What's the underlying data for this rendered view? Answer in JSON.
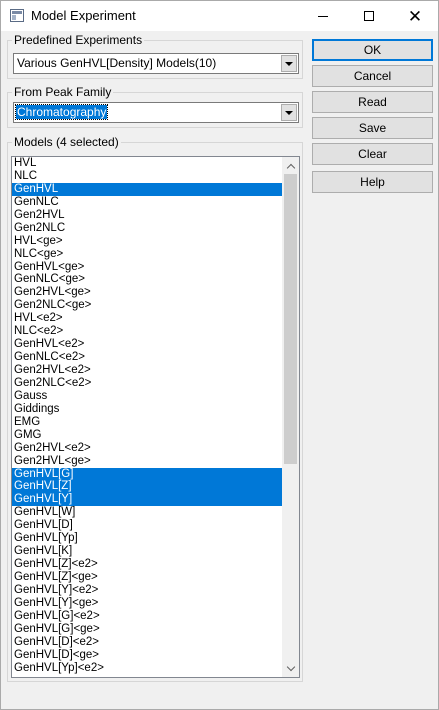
{
  "window": {
    "title": "Model Experiment"
  },
  "predefined": {
    "legend": "Predefined Experiments",
    "value": "Various GenHVL[Density] Models(10)"
  },
  "peak_family": {
    "legend": "From Peak Family",
    "value": "Chromatography"
  },
  "models": {
    "legend": "Models (4 selected)",
    "items": [
      {
        "label": "HVL",
        "selected": false
      },
      {
        "label": "NLC",
        "selected": false
      },
      {
        "label": "GenHVL",
        "selected": true
      },
      {
        "label": "GenNLC",
        "selected": false
      },
      {
        "label": "Gen2HVL",
        "selected": false
      },
      {
        "label": "Gen2NLC",
        "selected": false
      },
      {
        "label": "HVL<ge>",
        "selected": false
      },
      {
        "label": "NLC<ge>",
        "selected": false
      },
      {
        "label": "GenHVL<ge>",
        "selected": false
      },
      {
        "label": "GenNLC<ge>",
        "selected": false
      },
      {
        "label": "Gen2HVL<ge>",
        "selected": false
      },
      {
        "label": "Gen2NLC<ge>",
        "selected": false
      },
      {
        "label": "HVL<e2>",
        "selected": false
      },
      {
        "label": "NLC<e2>",
        "selected": false
      },
      {
        "label": "GenHVL<e2>",
        "selected": false
      },
      {
        "label": "GenNLC<e2>",
        "selected": false
      },
      {
        "label": "Gen2HVL<e2>",
        "selected": false
      },
      {
        "label": "Gen2NLC<e2>",
        "selected": false
      },
      {
        "label": "Gauss",
        "selected": false
      },
      {
        "label": "Giddings",
        "selected": false
      },
      {
        "label": "EMG",
        "selected": false
      },
      {
        "label": "GMG",
        "selected": false
      },
      {
        "label": "Gen2HVL<e2>",
        "selected": false
      },
      {
        "label": "Gen2HVL<ge>",
        "selected": false
      },
      {
        "label": "GenHVL[G]",
        "selected": true
      },
      {
        "label": "GenHVL[Z]",
        "selected": true
      },
      {
        "label": "GenHVL[Y]",
        "selected": true
      },
      {
        "label": "GenHVL[W]",
        "selected": false
      },
      {
        "label": "GenHVL[D]",
        "selected": false
      },
      {
        "label": "GenHVL[Yp]",
        "selected": false
      },
      {
        "label": "GenHVL[K]",
        "selected": false
      },
      {
        "label": "GenHVL[Z]<e2>",
        "selected": false
      },
      {
        "label": "GenHVL[Z]<ge>",
        "selected": false
      },
      {
        "label": "GenHVL[Y]<e2>",
        "selected": false
      },
      {
        "label": "GenHVL[Y]<ge>",
        "selected": false
      },
      {
        "label": "GenHVL[G]<e2>",
        "selected": false
      },
      {
        "label": "GenHVL[G]<ge>",
        "selected": false
      },
      {
        "label": "GenHVL[D]<e2>",
        "selected": false
      },
      {
        "label": "GenHVL[D]<ge>",
        "selected": false
      },
      {
        "label": "GenHVL[Yp]<e2>",
        "selected": false
      }
    ]
  },
  "buttons": {
    "ok": "OK",
    "cancel": "Cancel",
    "read": "Read",
    "save": "Save",
    "clear": "Clear",
    "help": "Help"
  },
  "colors": {
    "selection": "#0078d7",
    "dialog_bg": "#f0f0f0"
  }
}
